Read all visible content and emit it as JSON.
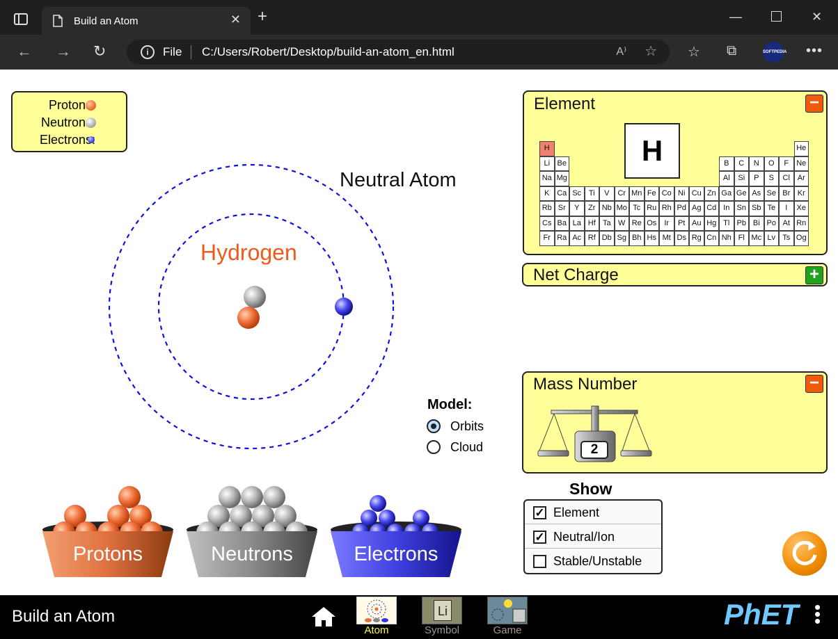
{
  "browser": {
    "tab_title": "Build an Atom",
    "new_tab_symbol": "+",
    "address_scheme": "File",
    "url": "C:/Users/Robert/Desktop/build-an-atom_en.html",
    "profile_badge": "SOFTPEDIA",
    "window_controls": [
      "minimize-icon",
      "maximize-icon",
      "close-icon"
    ]
  },
  "legend": {
    "protons_label": "Protons:",
    "neutrons_label": "Neutrons:",
    "electrons_label": "Electrons:"
  },
  "atom": {
    "neutral_label": "Neutral Atom",
    "element_name": "Hydrogen",
    "protons": 1,
    "neutrons": 1,
    "electrons": 1
  },
  "model": {
    "title": "Model:",
    "options": [
      "Orbits",
      "Cloud"
    ],
    "selected": "Orbits"
  },
  "buckets": {
    "protons": "Protons",
    "neutrons": "Neutrons",
    "electrons": "Electrons"
  },
  "element_panel": {
    "title": "Element",
    "symbol": "H",
    "toggle": "−"
  },
  "periodic_table": {
    "rows": [
      [
        "H",
        "He"
      ],
      [
        "Li",
        "Be",
        "B",
        "C",
        "N",
        "O",
        "F",
        "Ne"
      ],
      [
        "Na",
        "Mg",
        "Al",
        "Si",
        "P",
        "S",
        "Cl",
        "Ar"
      ],
      [
        "K",
        "Ca",
        "Sc",
        "Ti",
        "V",
        "Cr",
        "Mn",
        "Fe",
        "Co",
        "Ni",
        "Cu",
        "Zn",
        "Ga",
        "Ge",
        "As",
        "Se",
        "Br",
        "Kr"
      ],
      [
        "Rb",
        "Sr",
        "Y",
        "Zr",
        "Nb",
        "Mo",
        "Tc",
        "Ru",
        "Rh",
        "Pd",
        "Ag",
        "Cd",
        "In",
        "Sn",
        "Sb",
        "Te",
        "I",
        "Xe"
      ],
      [
        "Cs",
        "Ba",
        "La",
        "Hf",
        "Ta",
        "W",
        "Re",
        "Os",
        "Ir",
        "Pt",
        "Au",
        "Hg",
        "Tl",
        "Pb",
        "Bi",
        "Po",
        "At",
        "Rn"
      ],
      [
        "Fr",
        "Ra",
        "Ac",
        "Rf",
        "Db",
        "Sg",
        "Bh",
        "Hs",
        "Mt",
        "Ds",
        "Rg",
        "Cn",
        "Nh",
        "Fl",
        "Mc",
        "Lv",
        "Ts",
        "Og"
      ]
    ],
    "highlighted": "H"
  },
  "net_charge_panel": {
    "title": "Net Charge",
    "toggle": "+"
  },
  "mass_panel": {
    "title": "Mass Number",
    "value": "2",
    "toggle": "−"
  },
  "show": {
    "title": "Show",
    "options": [
      {
        "label": "Element",
        "checked": true
      },
      {
        "label": "Neutral/Ion",
        "checked": true
      },
      {
        "label": "Stable/Unstable",
        "checked": false
      }
    ]
  },
  "navbar": {
    "sim_title": "Build an Atom",
    "screens": [
      "Atom",
      "Symbol",
      "Game"
    ],
    "active_screen": "Atom",
    "logo": "PhET"
  },
  "colors": {
    "panel_bg": "#ffff99",
    "proton": "#f0703a",
    "neutron": "#b0b0b0",
    "electron": "#3a3aee",
    "element_name": "#f05a1a"
  }
}
